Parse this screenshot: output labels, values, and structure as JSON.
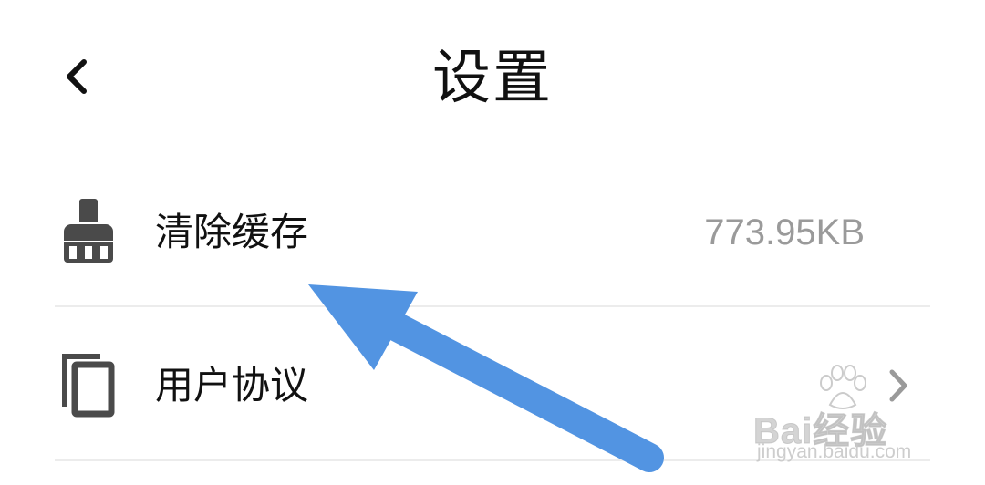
{
  "header": {
    "title": "设置",
    "back_icon": "chevron-left-icon"
  },
  "settings": {
    "items": [
      {
        "icon": "broom-icon",
        "label": "清除缓存",
        "value": "773.95KB"
      },
      {
        "icon": "copy-document-icon",
        "label": "用户协议",
        "trailing_icon": "chevron-right-icon"
      }
    ]
  },
  "annotation": {
    "color": "#5294e2"
  },
  "watermark": {
    "logo_text": "Bai经验",
    "url": "jingyan.baidu.com"
  }
}
